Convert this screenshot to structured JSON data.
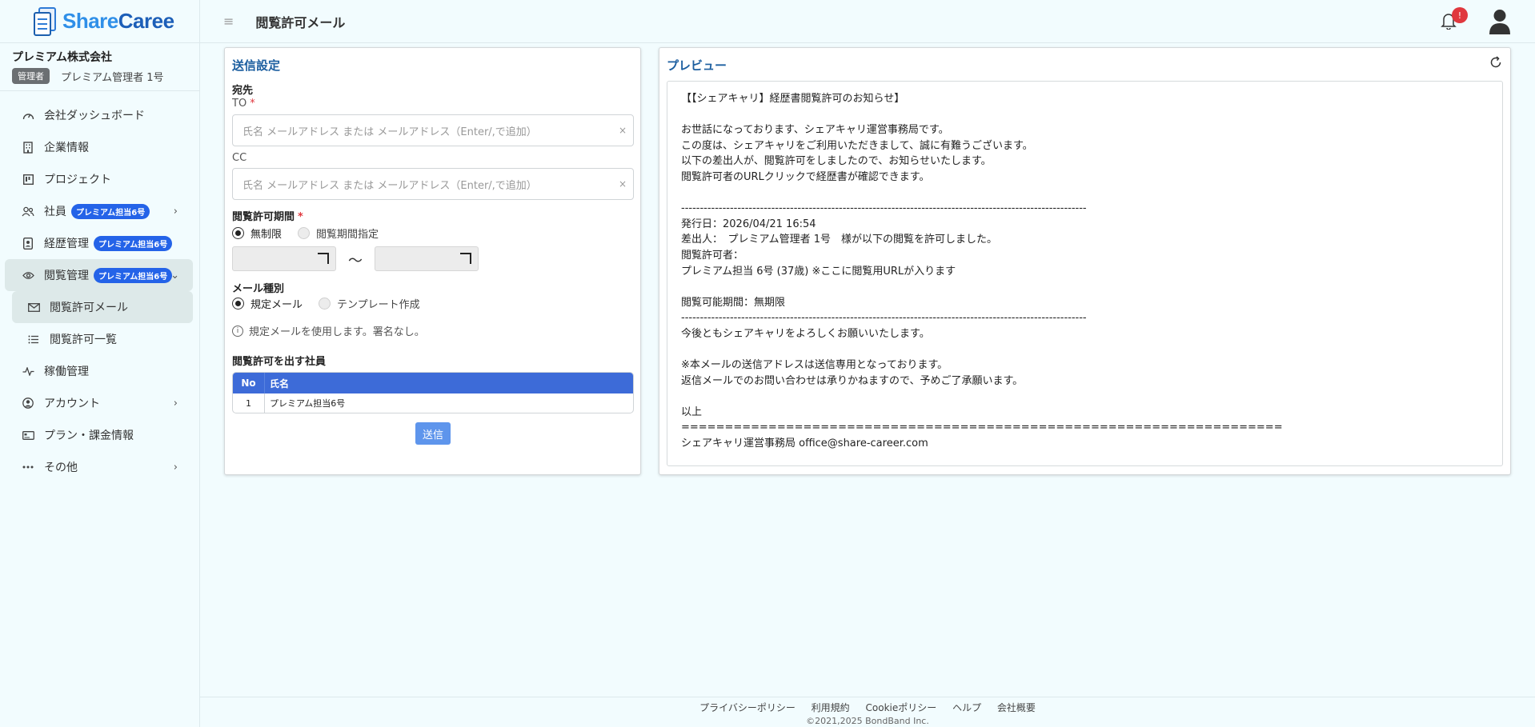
{
  "app": {
    "logo_share": "Share",
    "logo_caree": "Caree",
    "page_title": "閲覧許可メール",
    "notification_count": "!"
  },
  "company": {
    "name": "プレミアム株式会社",
    "role": "管理者",
    "user": "プレミアム管理者 1号"
  },
  "nav": {
    "dashboard": "会社ダッシュボード",
    "company_info": "企業情報",
    "project": "プロジェクト",
    "employees": "社員",
    "employees_badge": "プレミアム担当6号",
    "resume": "経歴管理",
    "resume_badge": "プレミアム担当6号",
    "view": "閲覧管理",
    "view_badge": "プレミアム担当6号",
    "view_mail": "閲覧許可メール",
    "view_list": "閲覧許可一覧",
    "operation": "稼働管理",
    "account": "アカウント",
    "plan": "プラン・課金情報",
    "other": "その他"
  },
  "form": {
    "title": "送信設定",
    "recipient": "宛先",
    "to_label": "TO",
    "required": "*",
    "to_placeholder": "氏名 メールアドレス または メールアドレス（Enter/,で追加）",
    "cc_label": "CC",
    "cc_placeholder": "氏名 メールアドレス または メールアドレス（Enter/,で追加）",
    "clear": "×",
    "period_label": "閲覧許可期間",
    "period_unlimited": "無制限",
    "period_specified": "閲覧期間指定",
    "tilde": "〜",
    "mail_type_label": "メール種別",
    "mail_type_default": "規定メール",
    "mail_type_template": "テンプレート作成",
    "info_text": "規定メールを使用します。署名なし。",
    "info_icon": "i",
    "employees_label": "閲覧許可を出す社員",
    "table": {
      "headers": [
        "No",
        "氏名"
      ],
      "rows": [
        [
          "1",
          "プレミアム担当6号"
        ]
      ]
    },
    "send": "送信"
  },
  "preview": {
    "title": "プレビュー",
    "lines": [
      "【【シェアキャリ】経歴書閲覧許可のお知らせ】",
      "",
      "お世話になっております、シェアキャリ運営事務局です。",
      "この度は、シェアキャリをご利用いただきまして、誠に有難うございます。",
      "以下の差出人が、閲覧許可をしましたので、お知らせいたします。",
      "閲覧許可者のURLクリックで経歴書が確認できます。",
      "",
      "------------------------------------------------------------------------------------------------------------",
      "発行日：2026/04/21 16:54",
      "差出人：　プレミアム管理者 1号　様が以下の閲覧を許可しました。",
      "閲覧許可者：",
      "プレミアム担当 6号 (37歳) ※ここに閲覧用URLが入ります",
      "",
      "閲覧可能期間：無期限",
      "------------------------------------------------------------------------------------------------------------",
      "今後ともシェアキャリをよろしくお願いいたします。",
      "",
      "※本メールの送信アドレスは送信専用となっております。",
      "返信メールでのお問い合わせは承りかねますので、予めご了承願います。",
      "",
      "以上",
      "=====================================================================",
      "シェアキャリ運営事務局 office@share-career.com"
    ]
  },
  "footer": {
    "privacy": "プライバシーポリシー",
    "terms": "利用規約",
    "cookie": "Cookieポリシー",
    "help": "ヘルプ",
    "about": "会社概要",
    "copyright": "©2021,2025 BondBand Inc."
  },
  "colors": {
    "accent": "#2463e8",
    "table_header": "#3d6bd8",
    "send_button": "#5e95ec",
    "title_blue": "#1d5fa0",
    "notification": "#e0383e"
  }
}
